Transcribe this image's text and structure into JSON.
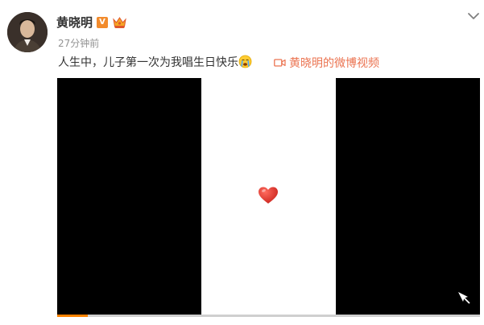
{
  "post": {
    "username": "黄晓明",
    "vip_badge": "V",
    "timestamp": "27分钟前",
    "text": "人生中，儿子第一次为我唱生日快乐",
    "emoji": "cry-emoji",
    "video_link_label": "黄晓明的微博视频"
  },
  "video": {
    "progress": 0.073
  },
  "colors": {
    "link": "#eb7350",
    "vip_badge": "#f28b2c",
    "progress": "#ff8200",
    "heart": "#e0312b"
  }
}
